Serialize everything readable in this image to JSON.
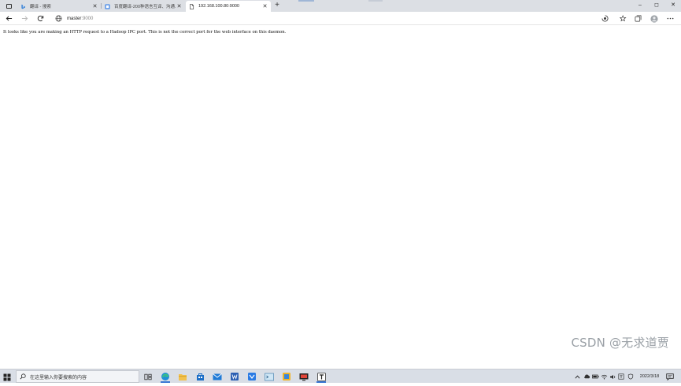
{
  "browser": {
    "tabs": [
      {
        "title": "翻译 - 搜索",
        "active": false,
        "favicon": "bing-search-icon"
      },
      {
        "title": "百度翻译-200种语言互译、沟通...",
        "active": false,
        "favicon": "baidu-translate-icon"
      },
      {
        "title": "192.168.100.80:9000",
        "active": true,
        "favicon": "page-icon"
      }
    ],
    "new_tab_label": "+",
    "window_controls": {
      "minimize": "–",
      "maximize": "◻",
      "close": "✕"
    },
    "address": {
      "host": "master",
      "port": ":9000"
    }
  },
  "page": {
    "message": "It looks like you are making an HTTP request to a Hadoop IPC port. This is not the correct port for the web interface on this daemon."
  },
  "taskbar": {
    "search_placeholder": "在这里输入你要搜索的内容",
    "apps": [
      "task-view-icon",
      "edge-icon",
      "file-explorer-icon",
      "store-icon",
      "mail-icon",
      "word-icon",
      "app-icon",
      "terminal-icon",
      "cloud-app-icon",
      "screen-app-icon",
      "typora-icon"
    ],
    "date": "2022/3/18"
  },
  "watermark": "CSDN @无求道贾",
  "colors": {
    "tabstrip": "#dcdfe4",
    "taskbar": "#d9dee6",
    "accent": "#3b78d4"
  }
}
